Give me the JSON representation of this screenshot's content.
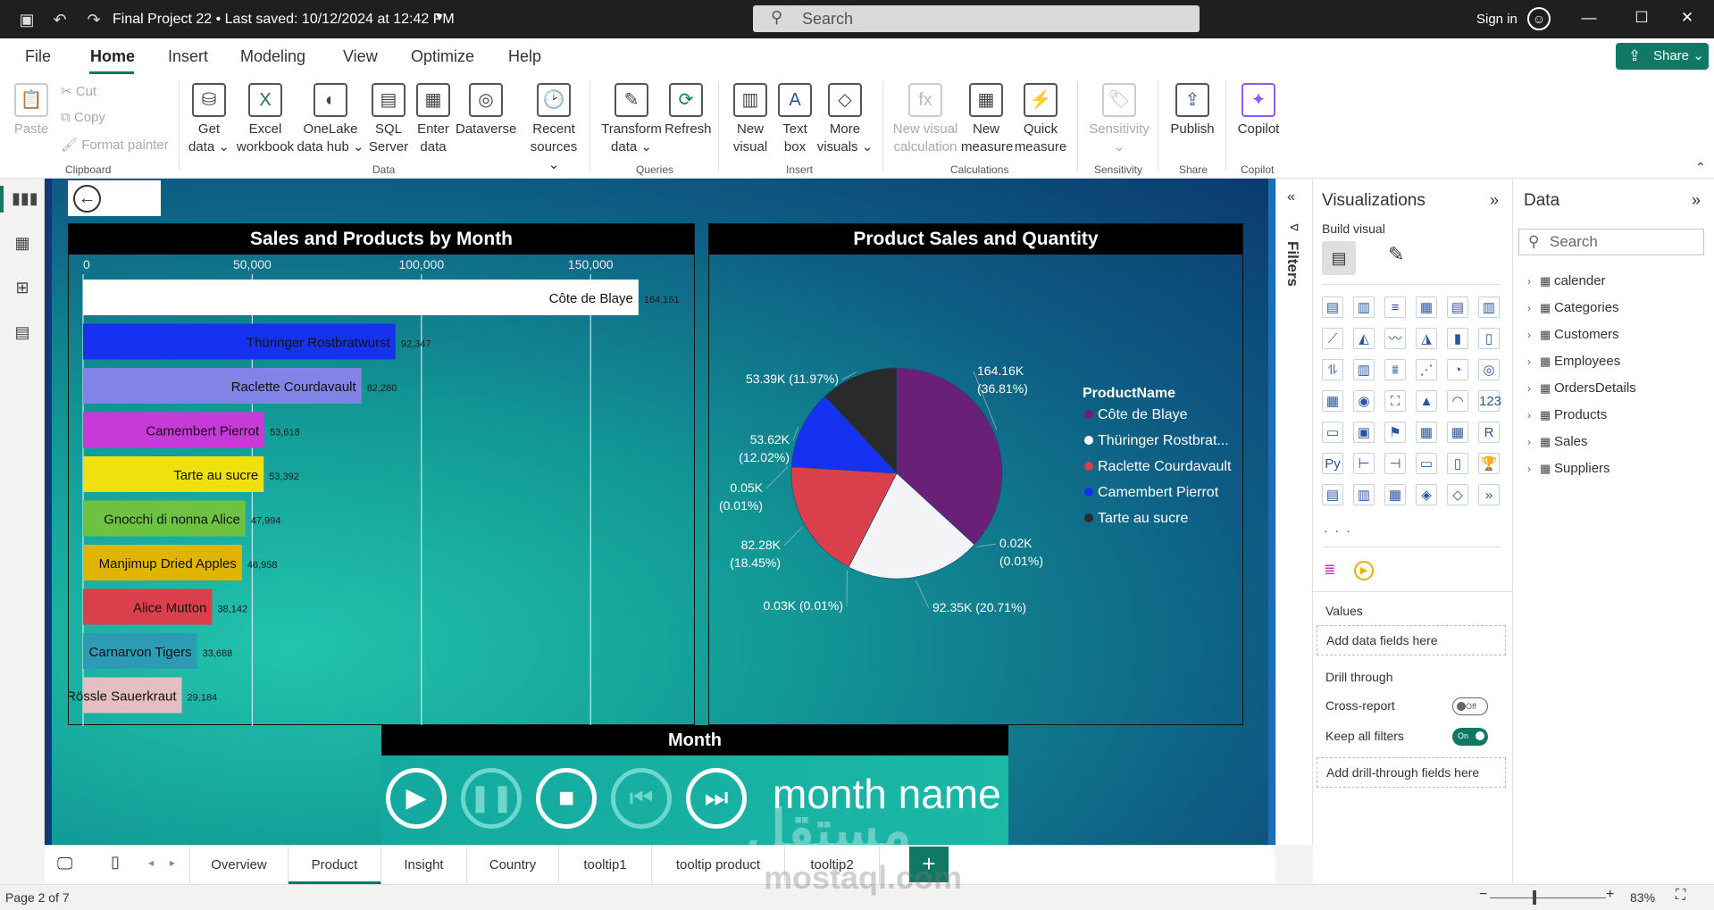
{
  "titlebar": {
    "doc_title": "Final Project 22 • Last saved: 10/12/2024 at 12:42 PM",
    "search_placeholder": "Search",
    "signin": "Sign in"
  },
  "menu": {
    "items": [
      "File",
      "Home",
      "Insert",
      "Modeling",
      "View",
      "Optimize",
      "Help"
    ],
    "active": "Home",
    "share": "Share"
  },
  "ribbon": {
    "clipboard": {
      "paste": "Paste",
      "cut": "Cut",
      "copy": "Copy",
      "format_painter": "Format painter",
      "label": "Clipboard"
    },
    "data": {
      "items": [
        {
          "line1": "Get",
          "line2": "data ⌄"
        },
        {
          "line1": "Excel",
          "line2": "workbook"
        },
        {
          "line1": "OneLake",
          "line2": "data hub ⌄"
        },
        {
          "line1": "SQL",
          "line2": "Server"
        },
        {
          "line1": "Enter",
          "line2": "data"
        },
        {
          "line1": "Dataverse",
          "line2": ""
        },
        {
          "line1": "Recent",
          "line2": "sources ⌄"
        }
      ],
      "label": "Data"
    },
    "queries": {
      "transform": {
        "line1": "Transform",
        "line2": "data ⌄"
      },
      "refresh": "Refresh",
      "label": "Queries"
    },
    "insert": {
      "new_visual": {
        "line1": "New",
        "line2": "visual"
      },
      "text_box": {
        "line1": "Text",
        "line2": "box"
      },
      "more_visuals": {
        "line1": "More",
        "line2": "visuals ⌄"
      },
      "label": "Insert"
    },
    "calculations": {
      "new_visual_calc": {
        "line1": "New visual",
        "line2": "calculation"
      },
      "new_measure": {
        "line1": "New",
        "line2": "measure"
      },
      "quick_measure": {
        "line1": "Quick",
        "line2": "measure"
      },
      "label": "Calculations"
    },
    "sensitivity": {
      "btn": "Sensitivity",
      "label": "Sensitivity"
    },
    "share": {
      "publish": "Publish",
      "label": "Share"
    },
    "copilot": {
      "btn": "Copilot",
      "label": "Copilot"
    }
  },
  "bar_visual": {
    "title": "Sales and Products by Month",
    "chart_data": {
      "type": "bar",
      "orientation": "horizontal",
      "title": "Sales and Products by Month",
      "categories": [
        "Côte de Blaye",
        "Thüringer Rostbratwurst",
        "Raclette Courdavault",
        "Camembert Pierrot",
        "Tarte au sucre",
        "Gnocchi di nonna Alice",
        "Manjimup Dried Apples",
        "Alice Mutton",
        "Carnarvon Tigers",
        "Rössle Sauerkraut"
      ],
      "values": [
        164161,
        92347,
        82280,
        53618,
        53392,
        47994,
        46958,
        38142,
        33688,
        29184
      ],
      "value_labels": [
        "164,161",
        "92,347",
        "82,280",
        "53,618",
        "53,392",
        "47,994",
        "46,958",
        "38,142",
        "33,688",
        "29,184"
      ],
      "colors": [
        "#ffffff",
        "#1632f0",
        "#8283e6",
        "#c839d9",
        "#efe10e",
        "#6dc241",
        "#e0b400",
        "#d9404c",
        "#2c9bb3",
        "#e3bfc2"
      ],
      "xticks": [
        0,
        50000,
        100000,
        150000
      ],
      "xtick_labels": [
        "0",
        "50,000",
        "100,000",
        "150,000"
      ],
      "xlim": [
        0,
        170000
      ],
      "grid": true
    }
  },
  "pie_visual": {
    "title": "Product Sales and Quantity",
    "chart_data": {
      "type": "pie",
      "title": "Product Sales and Quantity",
      "legend_title": "ProductName",
      "legend_placement": "right",
      "legend": [
        {
          "name": "Côte de Blaye",
          "color": "#6b2078"
        },
        {
          "name": "Thüringer Rostbrat...",
          "color": "#ffffff"
        },
        {
          "name": "Raclette Courdavault",
          "color": "#d9404c"
        },
        {
          "name": "Camembert Pierrot",
          "color": "#1632f0"
        },
        {
          "name": "Tarte au sucre",
          "color": "#2a2a2a"
        }
      ],
      "slices": [
        {
          "value_k": 164.16,
          "pct": 36.81,
          "color": "#6b2078",
          "label1": "164.16K",
          "label2": "(36.81%)"
        },
        {
          "value_k": 0.02,
          "pct": 0.01,
          "color": "#9aa0a6",
          "label1": "0.02K",
          "label2": "(0.01%)"
        },
        {
          "value_k": 92.35,
          "pct": 20.71,
          "color": "#f4f4f6",
          "label1": "92.35K (20.71%)",
          "label2": ""
        },
        {
          "value_k": 0.03,
          "pct": 0.01,
          "color": "#9aa0a6",
          "label1": "0.03K (0.01%)",
          "label2": ""
        },
        {
          "value_k": 82.28,
          "pct": 18.45,
          "color": "#d9404c",
          "label1": "82.28K",
          "label2": "(18.45%)"
        },
        {
          "value_k": 0.05,
          "pct": 0.01,
          "color": "#9aa0a6",
          "label1": "0.05K",
          "label2": "(0.01%)"
        },
        {
          "value_k": 53.62,
          "pct": 12.02,
          "color": "#1632f0",
          "label1": "53.62K",
          "label2": "(12.02%)"
        },
        {
          "value_k": 53.39,
          "pct": 11.97,
          "color": "#2a2a2a",
          "label1": "53.39K (11.97%)",
          "label2": ""
        }
      ]
    }
  },
  "player": {
    "title": "Month",
    "month_name": "month name"
  },
  "filters": {
    "label": "Filters"
  },
  "viz_pane": {
    "title": "Visualizations",
    "build_visual": "Build visual",
    "values_label": "Values",
    "values_placeholder": "Add data fields here",
    "drill_through": "Drill through",
    "cross_report": "Cross-report",
    "cross_report_state": "Off",
    "keep_filters": "Keep all filters",
    "keep_filters_state": "On",
    "drill_placeholder": "Add drill-through fields here",
    "more": "· · ·"
  },
  "data_pane": {
    "title": "Data",
    "search_placeholder": "Search",
    "tables": [
      "calender",
      "Categories",
      "Customers",
      "Employees",
      "OrdersDetails",
      "Products",
      "Sales",
      "Suppliers"
    ]
  },
  "page_tabs": {
    "tabs": [
      "Overview",
      "Product",
      "Insight",
      "Country",
      "tooltip1",
      "tooltip product",
      "tooltip2"
    ],
    "active": "Product",
    "add": "+"
  },
  "status": {
    "page": "Page 2 of 7",
    "zoom": "83%"
  },
  "watermark": {
    "line1": "مستقل",
    "line2": "mostaql.com"
  }
}
